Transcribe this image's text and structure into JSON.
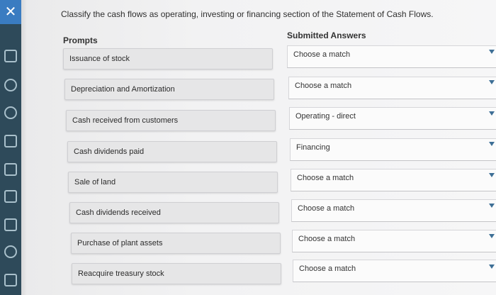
{
  "instruction": "Classify the cash flows as operating, investing or financing section of the Statement of Cash Flows.",
  "headers": {
    "prompts": "Prompts",
    "answers": "Submitted Answers"
  },
  "rows": [
    {
      "prompt": "Issuance of stock",
      "answer": "Choose a match"
    },
    {
      "prompt": "Depreciation and Amortization",
      "answer": "Choose a match"
    },
    {
      "prompt": "Cash received from customers",
      "answer": "Operating - direct"
    },
    {
      "prompt": "Cash dividends paid",
      "answer": "Financing"
    },
    {
      "prompt": "Sale of land",
      "answer": "Choose a match"
    },
    {
      "prompt": "Cash dividends received",
      "answer": "Choose a match"
    },
    {
      "prompt": "Purchase of plant assets",
      "answer": "Choose a match"
    },
    {
      "prompt": "Reacquire treasury stock",
      "answer": "Choose a match"
    }
  ],
  "sidebar": {
    "close_glyph": "✕",
    "icons": [
      "calendar-icon",
      "user-icon",
      "globe-icon",
      "document-icon",
      "grid-icon",
      "image-icon",
      "book-icon",
      "tools-icon",
      "edit-icon"
    ]
  },
  "colors": {
    "sidebar": "#2e4a5a",
    "sidebar_top": "#3a7cc1",
    "caret": "#3e6f96"
  }
}
